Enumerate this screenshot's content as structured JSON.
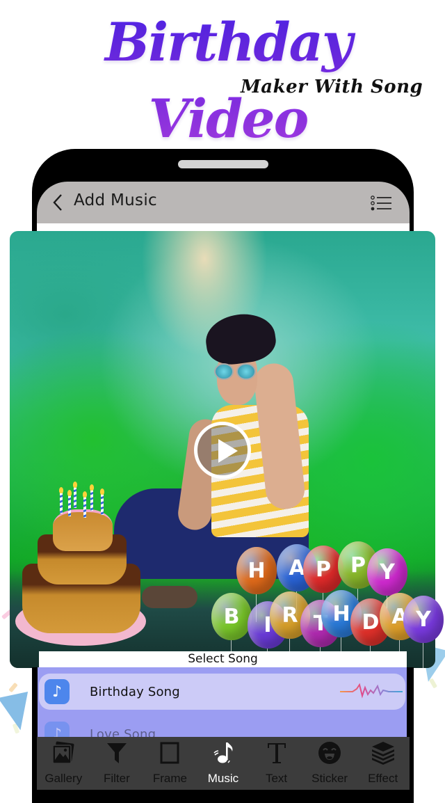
{
  "banner": {
    "title": "Birthday Video",
    "subtitle": "Maker With Song",
    "title_gradient": [
      "#4a22e8",
      "#b03ee8"
    ]
  },
  "header": {
    "back_icon": "chevron-left-icon",
    "title": "Add Music",
    "menu_icon": "list-menu-icon"
  },
  "preview": {
    "play_icon": "play-circle-icon",
    "overlay_text_top": "HAPPY",
    "overlay_text_bottom": "BIRTHDAY",
    "balloons_top": [
      "H",
      "A",
      "P",
      "P",
      "Y"
    ],
    "balloons_bottom": [
      "B",
      "I",
      "R",
      "T",
      "H",
      "D",
      "A",
      "Y"
    ]
  },
  "song_panel": {
    "title": "Select Song",
    "songs": [
      {
        "name": "Birthday Song",
        "icon": "music-note-icon",
        "selected": true
      },
      {
        "name": "Love Song",
        "icon": "music-note-icon",
        "selected": false
      }
    ],
    "accent": "#9b9df2",
    "selected_bg": "#cccbf7",
    "icon_color": "#4d86ec"
  },
  "toolbar": {
    "items": [
      {
        "label": "Gallery",
        "icon": "gallery-icon",
        "active": false
      },
      {
        "label": "Filter",
        "icon": "filter-icon",
        "active": false
      },
      {
        "label": "Frame",
        "icon": "frame-icon",
        "active": false
      },
      {
        "label": "Music",
        "icon": "music-icon",
        "active": true
      },
      {
        "label": "Text",
        "icon": "text-icon",
        "active": false
      },
      {
        "label": "Sticker",
        "icon": "sticker-icon",
        "active": false
      },
      {
        "label": "Effect",
        "icon": "effect-layers-icon",
        "active": false
      }
    ]
  }
}
